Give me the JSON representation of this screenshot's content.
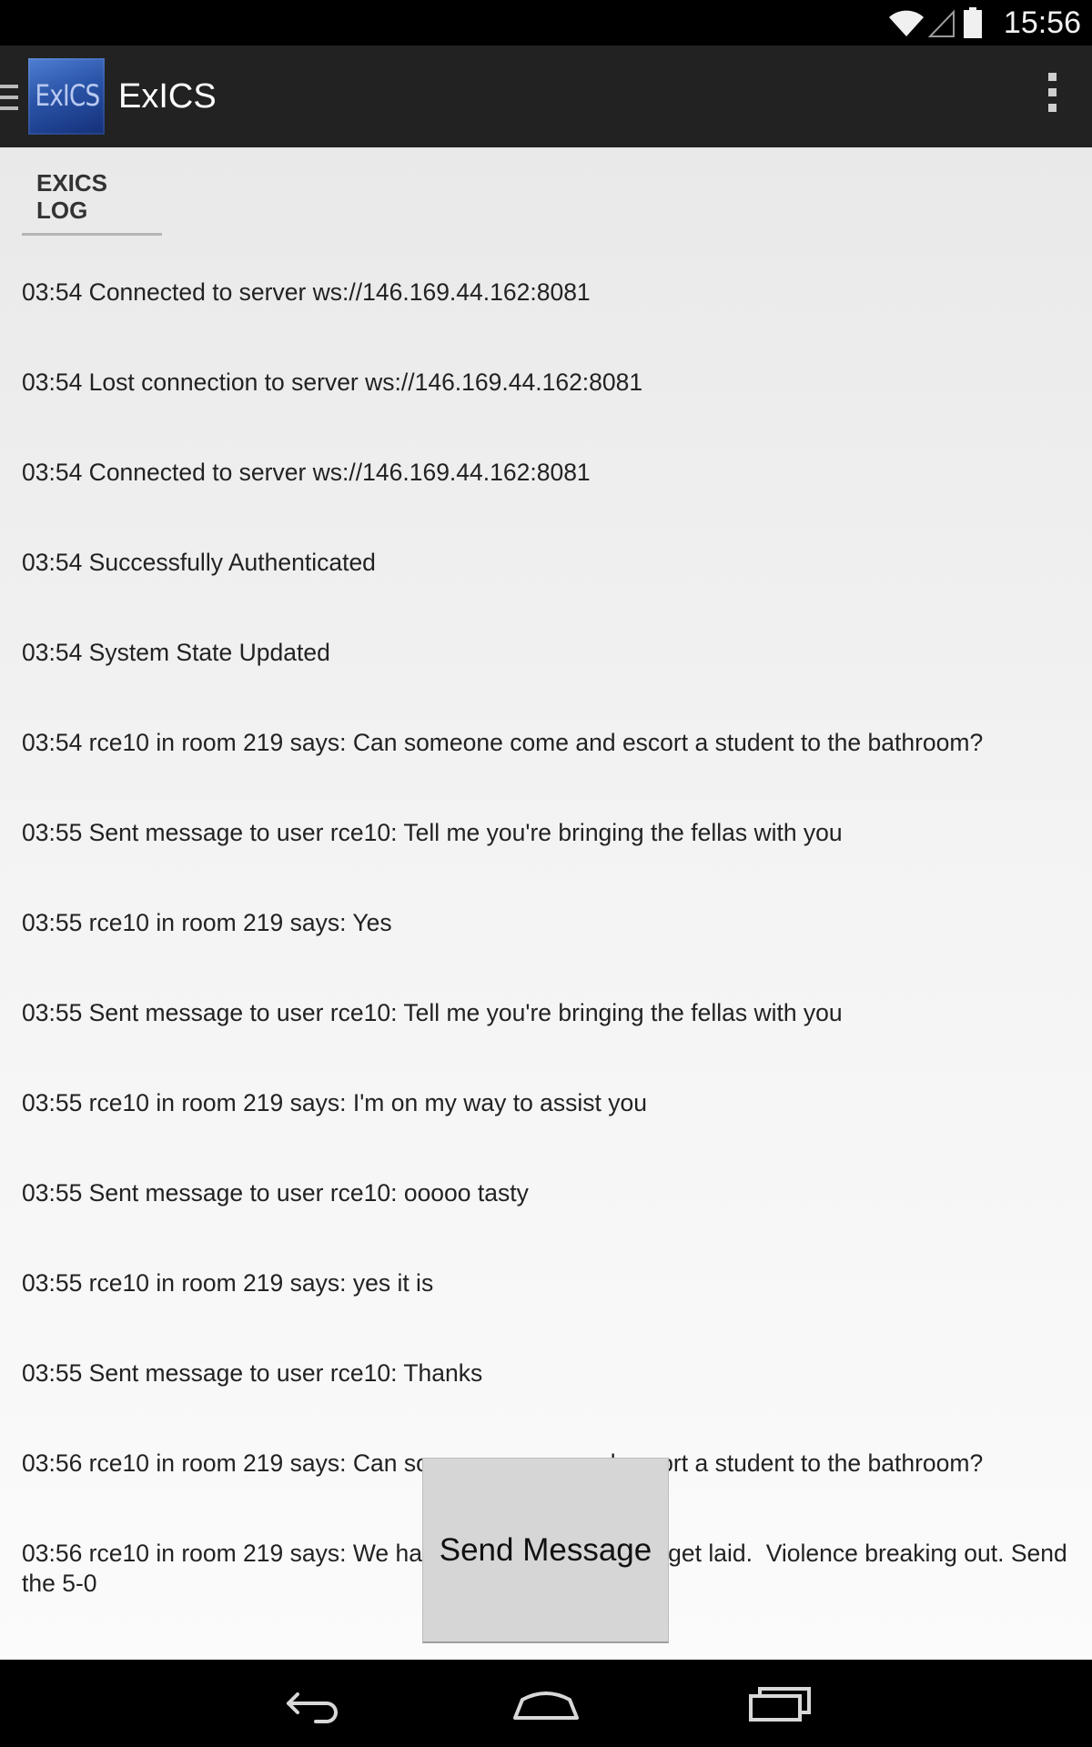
{
  "status_bar": {
    "time": "15:56",
    "icons": [
      "wifi-icon",
      "cell-signal-icon",
      "battery-icon"
    ]
  },
  "action_bar": {
    "title": "ExICS",
    "logo_text": "ExICS",
    "icons": [
      "drawer-indicator-icon",
      "overflow-menu-icon"
    ]
  },
  "log": {
    "header": "EXICS LOG",
    "lines": [
      "03:54 Connected to server ws://146.169.44.162:8081",
      "03:54 Lost connection to server ws://146.169.44.162:8081",
      "03:54 Connected to server ws://146.169.44.162:8081",
      "03:54 Successfully Authenticated",
      "03:54 System State Updated",
      "03:54 rce10 in room 219 says: Can someone come and escort a student to the bathroom?",
      "03:55 Sent message to user rce10: Tell me you're bringing the fellas with you",
      "03:55 rce10 in room 219 says: Yes",
      "03:55 Sent message to user rce10: Tell me you're bringing the fellas with you",
      "03:55 rce10 in room 219 says: I'm on my way to assist you",
      "03:55 Sent message to user rce10: ooooo tasty",
      "03:55 rce10 in room 219 says: yes it is",
      "03:55 Sent message to user rce10: Thanks",
      "03:56 rce10 in room 219 says: Can someone come and escort a student to the bathroom?",
      "03:56 rce10 in room 219 says: We have a student who can't get laid.  Violence breaking out. Send the 5-0"
    ]
  },
  "send_button": {
    "label": "Send Message"
  },
  "nav_bar": {
    "icons": [
      "back-icon",
      "home-icon",
      "recent-apps-icon"
    ]
  },
  "colors": {
    "action_bar": "#222222",
    "logo_blue": "#2a54a8",
    "button_gray": "#d6d6d6"
  }
}
